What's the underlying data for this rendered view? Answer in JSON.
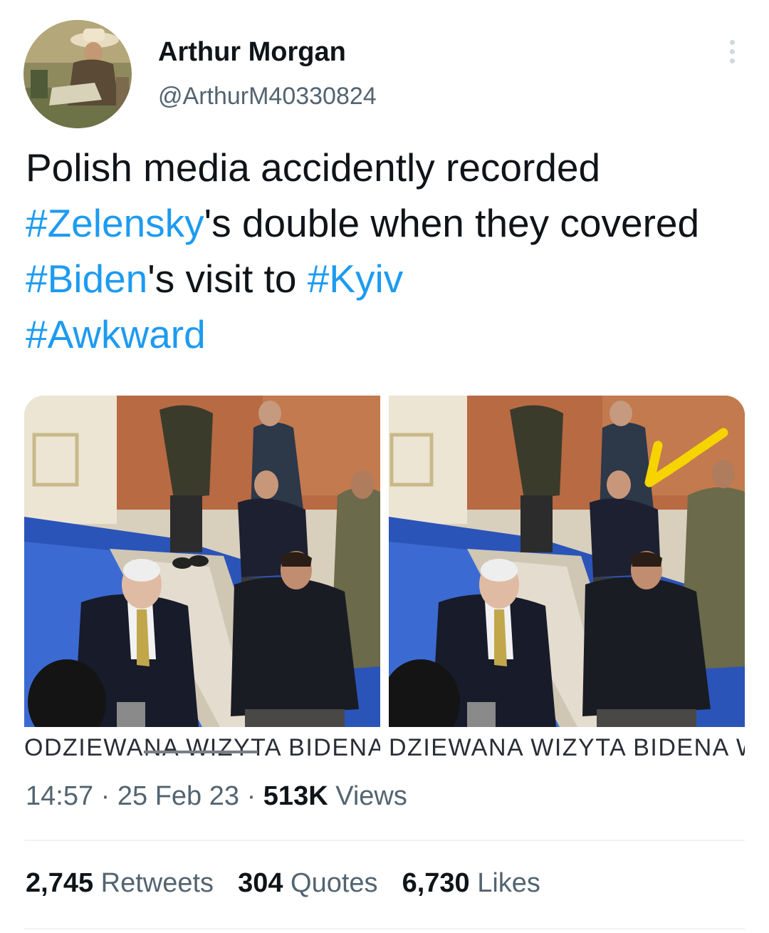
{
  "author": {
    "name": "Arthur Morgan",
    "handle": "@ArthurM40330824"
  },
  "tweet": {
    "text_parts": [
      {
        "type": "text",
        "text": "Polish media accidently recorded "
      },
      {
        "type": "hashtag",
        "text": "#Zelensky"
      },
      {
        "type": "text",
        "text": "'s double when they covered "
      },
      {
        "type": "hashtag",
        "text": "#Biden"
      },
      {
        "type": "text",
        "text": "'s visit to "
      },
      {
        "type": "hashtag",
        "text": "#Kyiv"
      },
      {
        "type": "text",
        "text": " "
      },
      {
        "type": "hashtag",
        "text": "#Awkward"
      }
    ]
  },
  "media": {
    "left_caption": "ODZIEWANA WIZYTA BIDENA",
    "right_caption": "DZIEWANA WIZYTA BIDENA W",
    "arrow_color": "#f5d400"
  },
  "meta": {
    "time": "14:57",
    "sep1": " · ",
    "date": "25 Feb 23",
    "sep2": " · ",
    "views_count": "513K",
    "views_label": " Views"
  },
  "stats": {
    "retweets_count": "2,745",
    "retweets_label": "Retweets",
    "quotes_count": "304",
    "quotes_label": "Quotes",
    "likes_count": "6,730",
    "likes_label": "Likes"
  },
  "colors": {
    "hashtag": "#1d9bf0",
    "secondary_text": "#536471",
    "divider": "#eff3f4"
  }
}
